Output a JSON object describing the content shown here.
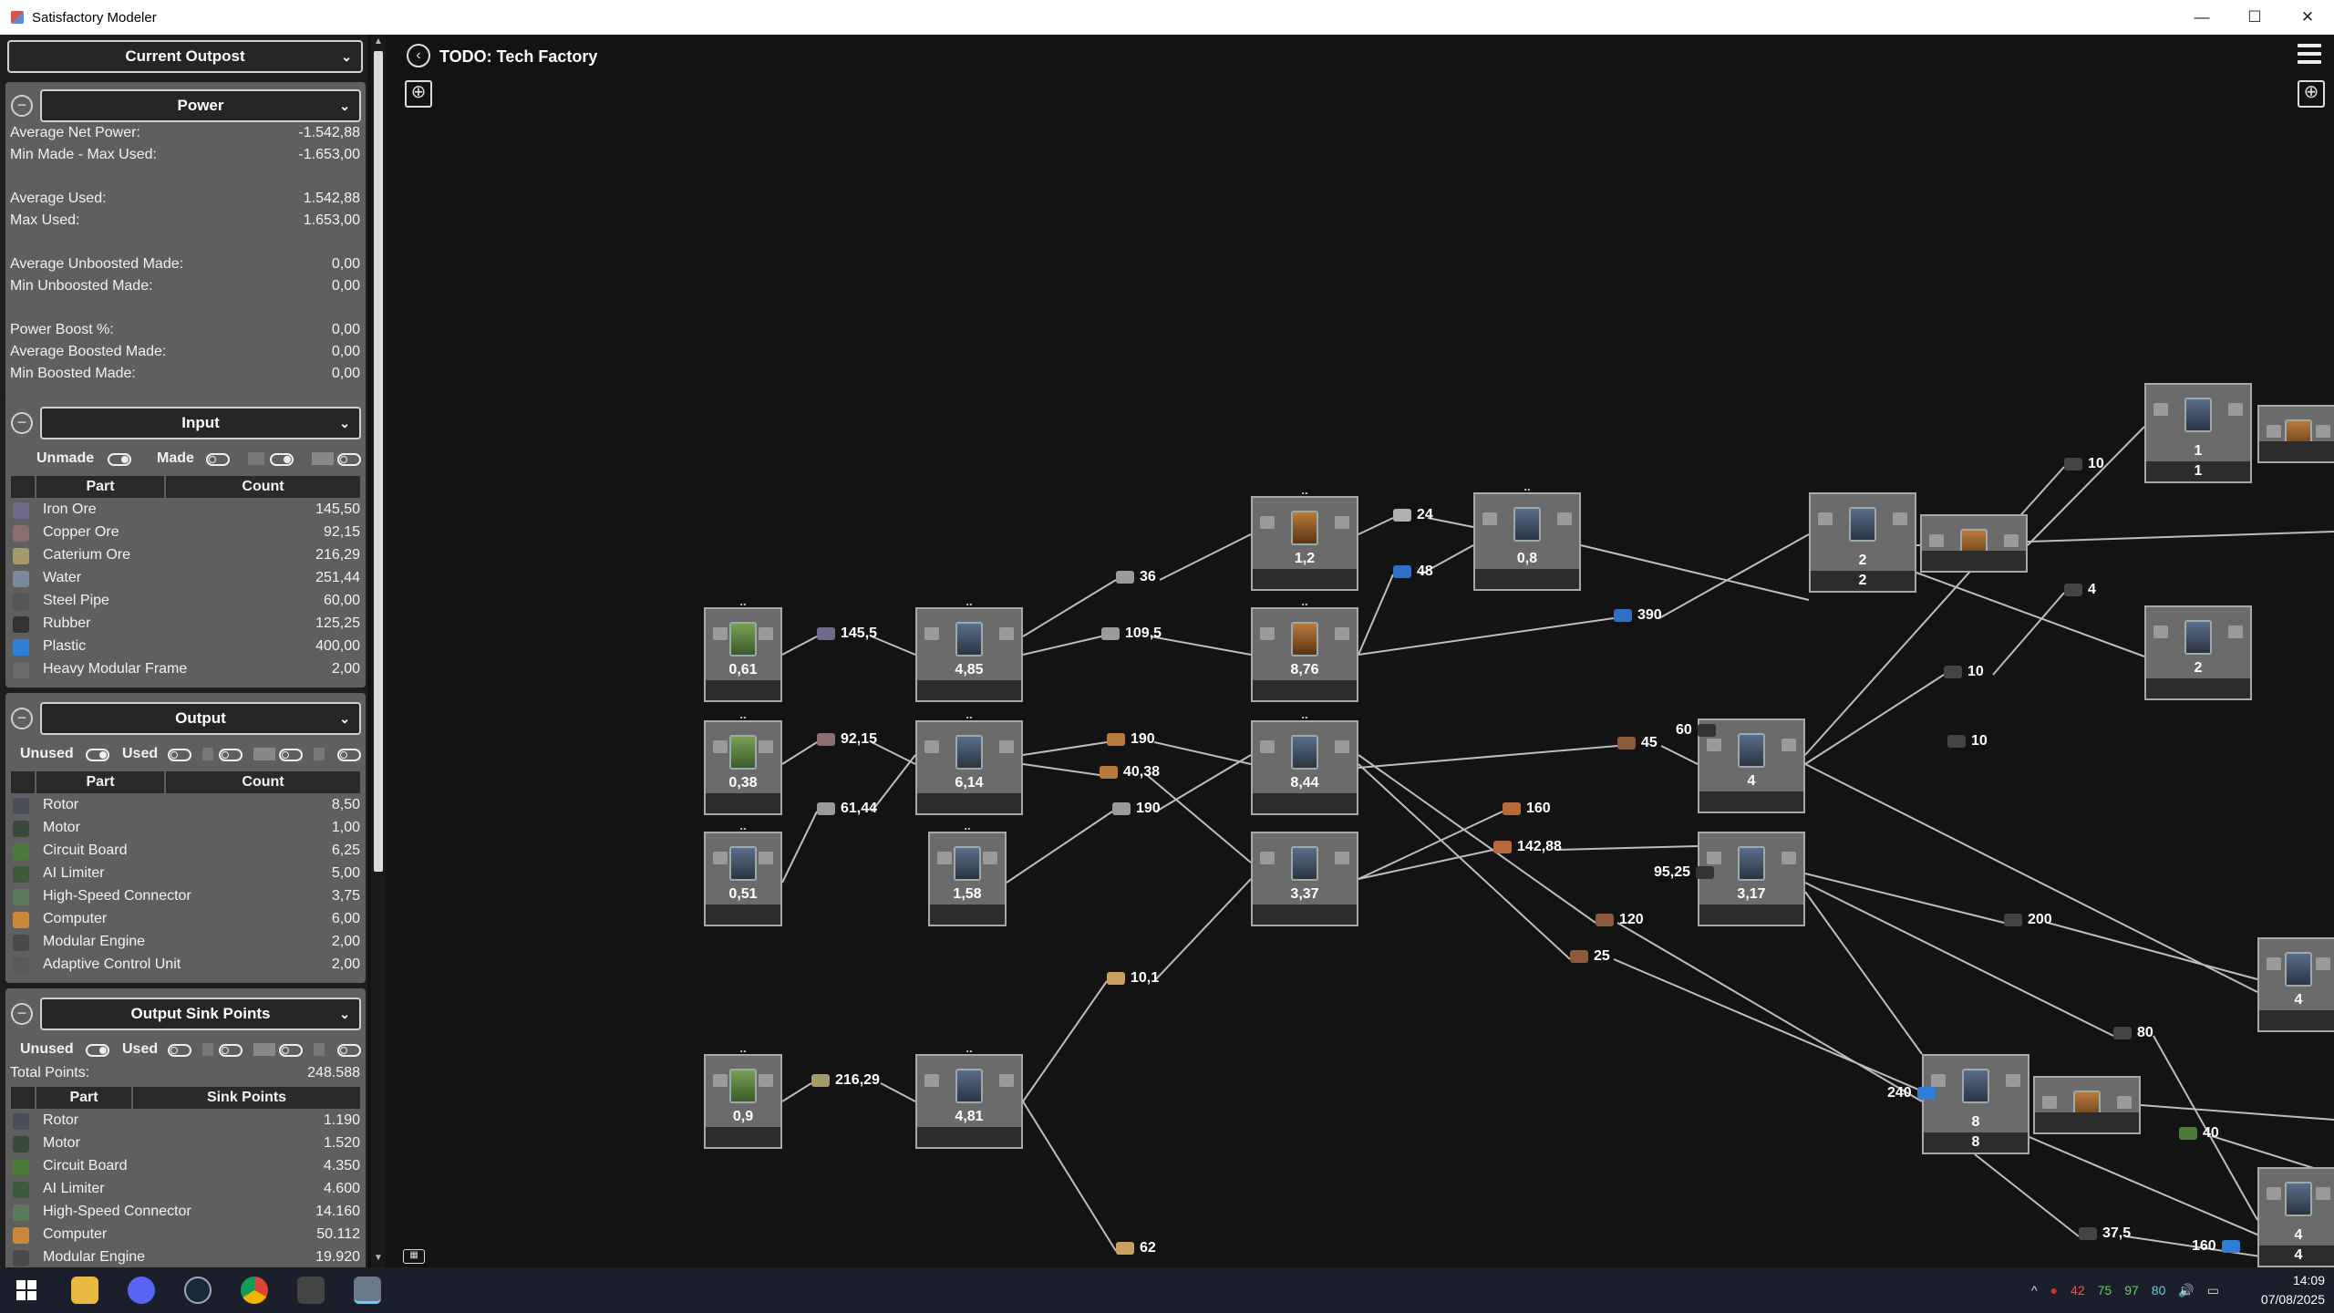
{
  "window": {
    "title": "Satisfactory Modeler",
    "min": "—",
    "max": "☐",
    "close": "✕"
  },
  "sidebar": {
    "outpost_dropdown": "Current Outpost",
    "power": {
      "dropdown": "Power",
      "rows": [
        {
          "k": "Average Net Power:",
          "v": "-1.542,88"
        },
        {
          "k": "Min Made - Max Used:",
          "v": "-1.653,00"
        },
        {
          "k": "Average Used:",
          "v": "1.542,88"
        },
        {
          "k": "Max Used:",
          "v": "1.653,00"
        },
        {
          "k": "Average Unboosted Made:",
          "v": "0,00"
        },
        {
          "k": "Min Unboosted Made:",
          "v": "0,00"
        },
        {
          "k": "Power Boost %:",
          "v": "0,00"
        },
        {
          "k": "Average Boosted Made:",
          "v": "0,00"
        },
        {
          "k": "Min Boosted Made:",
          "v": "0,00"
        }
      ]
    },
    "input": {
      "dropdown": "Input",
      "toggle1": "Unmade",
      "toggle2": "Made",
      "col_part": "Part",
      "col_count": "Count",
      "rows": [
        {
          "name": "Iron Ore",
          "count": "145,50",
          "color": "#6e6a8a"
        },
        {
          "name": "Copper Ore",
          "count": "92,15",
          "color": "#8a6e6e"
        },
        {
          "name": "Caterium Ore",
          "count": "216,29",
          "color": "#a59a6a"
        },
        {
          "name": "Water",
          "count": "251,44",
          "color": "#7a8a9a"
        },
        {
          "name": "Steel Pipe",
          "count": "60,00",
          "color": "#555555"
        },
        {
          "name": "Rubber",
          "count": "125,25",
          "color": "#333333"
        },
        {
          "name": "Plastic",
          "count": "400,00",
          "color": "#2f7fd6"
        },
        {
          "name": "Heavy Modular Frame",
          "count": "2,00",
          "color": "#6a6a6a"
        }
      ]
    },
    "output": {
      "dropdown": "Output",
      "toggle1": "Unused",
      "toggle2": "Used",
      "col_part": "Part",
      "col_count": "Count",
      "rows": [
        {
          "name": "Rotor",
          "count": "8,50",
          "color": "#4a4e5a"
        },
        {
          "name": "Motor",
          "count": "1,00",
          "color": "#3a4a3a"
        },
        {
          "name": "Circuit Board",
          "count": "6,25",
          "color": "#4a7a3a"
        },
        {
          "name": "AI Limiter",
          "count": "5,00",
          "color": "#3a5a3a"
        },
        {
          "name": "High-Speed Connector",
          "count": "3,75",
          "color": "#5a7a5a"
        },
        {
          "name": "Computer",
          "count": "6,00",
          "color": "#c88a3a"
        },
        {
          "name": "Modular Engine",
          "count": "2,00",
          "color": "#4a4a4a"
        },
        {
          "name": "Adaptive Control Unit",
          "count": "2,00",
          "color": "#5a5a5a"
        }
      ]
    },
    "sink": {
      "dropdown": "Output Sink Points",
      "toggle1": "Unused",
      "toggle2": "Used",
      "total_label": "Total Points:",
      "total_value": "248.588",
      "col_part": "Part",
      "col_points": "Sink Points",
      "rows": [
        {
          "name": "Rotor",
          "count": "1.190",
          "color": "#4a4e5a"
        },
        {
          "name": "Motor",
          "count": "1.520",
          "color": "#3a4a3a"
        },
        {
          "name": "Circuit Board",
          "count": "4.350",
          "color": "#4a7a3a"
        },
        {
          "name": "AI Limiter",
          "count": "4.600",
          "color": "#3a5a3a"
        },
        {
          "name": "High-Speed Connector",
          "count": "14.160",
          "color": "#5a7a5a"
        },
        {
          "name": "Computer",
          "count": "50.112",
          "color": "#c88a3a"
        },
        {
          "name": "Modular Engine",
          "count": "19.920",
          "color": "#4a4a4a"
        }
      ]
    }
  },
  "canvas": {
    "title": "TODO: Tech Factory",
    "dots": "..",
    "nodes": [
      {
        "id": "n1",
        "val": "0,61",
        "type": "green"
      },
      {
        "id": "n2",
        "val": "4,85",
        "type": "blue"
      },
      {
        "id": "n3",
        "val": "1,2",
        "type": "brown"
      },
      {
        "id": "n4",
        "val": "0,8",
        "type": "blue"
      },
      {
        "id": "n5",
        "val": "8,76",
        "type": "brown"
      },
      {
        "id": "n6",
        "val": "0,38",
        "type": "green"
      },
      {
        "id": "n7",
        "val": "6,14",
        "type": "blue"
      },
      {
        "id": "n8",
        "val": "8,44",
        "type": "blue"
      },
      {
        "id": "n9",
        "val": "0,51",
        "type": "blue"
      },
      {
        "id": "n10",
        "val": "1,58",
        "type": "blue"
      },
      {
        "id": "n11",
        "val": "3,37",
        "type": "blue"
      },
      {
        "id": "n12",
        "val": "0,9",
        "type": "green"
      },
      {
        "id": "n13",
        "val": "4,81",
        "type": "blue"
      },
      {
        "id": "n14",
        "val": "2",
        "foot": "2",
        "type": "blue"
      },
      {
        "id": "n15",
        "val": "",
        "type": "brown"
      },
      {
        "id": "n16",
        "val": "1",
        "foot": "1",
        "type": "blue"
      },
      {
        "id": "n17",
        "val": "2",
        "type": "blue"
      },
      {
        "id": "n18",
        "val": "4",
        "type": "blue"
      },
      {
        "id": "n19",
        "val": "3,17",
        "type": "blue"
      },
      {
        "id": "n20",
        "val": "8",
        "foot": "8",
        "type": "blue"
      },
      {
        "id": "n21",
        "val": "",
        "type": "brown"
      },
      {
        "id": "n22",
        "val": "4",
        "type": "blue"
      },
      {
        "id": "n23",
        "val": "4",
        "foot": "4",
        "type": "blue"
      },
      {
        "id": "n24",
        "val": "",
        "type": "brown"
      }
    ],
    "flows": [
      {
        "id": "f1",
        "v": "145,5",
        "c": "#6e6a8a"
      },
      {
        "id": "f2",
        "v": "109,5",
        "c": "#9a9a9a"
      },
      {
        "id": "f3",
        "v": "36",
        "c": "#9a9a9a"
      },
      {
        "id": "f4",
        "v": "24",
        "c": "#b0b0b0"
      },
      {
        "id": "f5",
        "v": "48",
        "c": "#2f6fc6"
      },
      {
        "id": "f6",
        "v": "390",
        "c": "#2f6fc6"
      },
      {
        "id": "f7",
        "v": "92,15",
        "c": "#8a6e6e"
      },
      {
        "id": "f8",
        "v": "190",
        "c": "#b87a3d"
      },
      {
        "id": "f9",
        "v": "40,38",
        "c": "#b87a3d"
      },
      {
        "id": "f10",
        "v": "61,44",
        "c": "#9a9a9a"
      },
      {
        "id": "f11",
        "v": "190",
        "c": "#9a9a9a"
      },
      {
        "id": "f12",
        "v": "160",
        "c": "#b86a3d"
      },
      {
        "id": "f13",
        "v": "142,88",
        "c": "#b86a3d"
      },
      {
        "id": "f14",
        "v": "45",
        "c": "#8a5a3a"
      },
      {
        "id": "f15",
        "v": "60",
        "c": "#333"
      },
      {
        "id": "f16",
        "v": "10",
        "c": "#444"
      },
      {
        "id": "f17",
        "v": "4",
        "c": "#444"
      },
      {
        "id": "f18",
        "v": "10",
        "c": "#444"
      },
      {
        "id": "f19",
        "v": "10",
        "c": "#444"
      },
      {
        "id": "f20",
        "v": "95,25",
        "c": "#333"
      },
      {
        "id": "f21",
        "v": "200",
        "c": "#444"
      },
      {
        "id": "f22",
        "v": "120",
        "c": "#8a5a3a"
      },
      {
        "id": "f23",
        "v": "25",
        "c": "#8a5a3a"
      },
      {
        "id": "f24",
        "v": "10,1",
        "c": "#c8a060"
      },
      {
        "id": "f25",
        "v": "216,29",
        "c": "#a59a6a"
      },
      {
        "id": "f26",
        "v": "80",
        "c": "#444"
      },
      {
        "id": "f27",
        "v": "240",
        "c": "#2f7fd6"
      },
      {
        "id": "f28",
        "v": "40",
        "c": "#4a7a3a"
      },
      {
        "id": "f29",
        "v": "37,5",
        "c": "#444"
      },
      {
        "id": "f30",
        "v": "160",
        "c": "#2f7fd6"
      },
      {
        "id": "f31",
        "v": "62",
        "c": "#c8a060"
      }
    ]
  },
  "taskbar": {
    "tray_nums": [
      "42",
      "75",
      "97",
      "80"
    ],
    "time": "14:09",
    "date": "07/08/2025"
  }
}
